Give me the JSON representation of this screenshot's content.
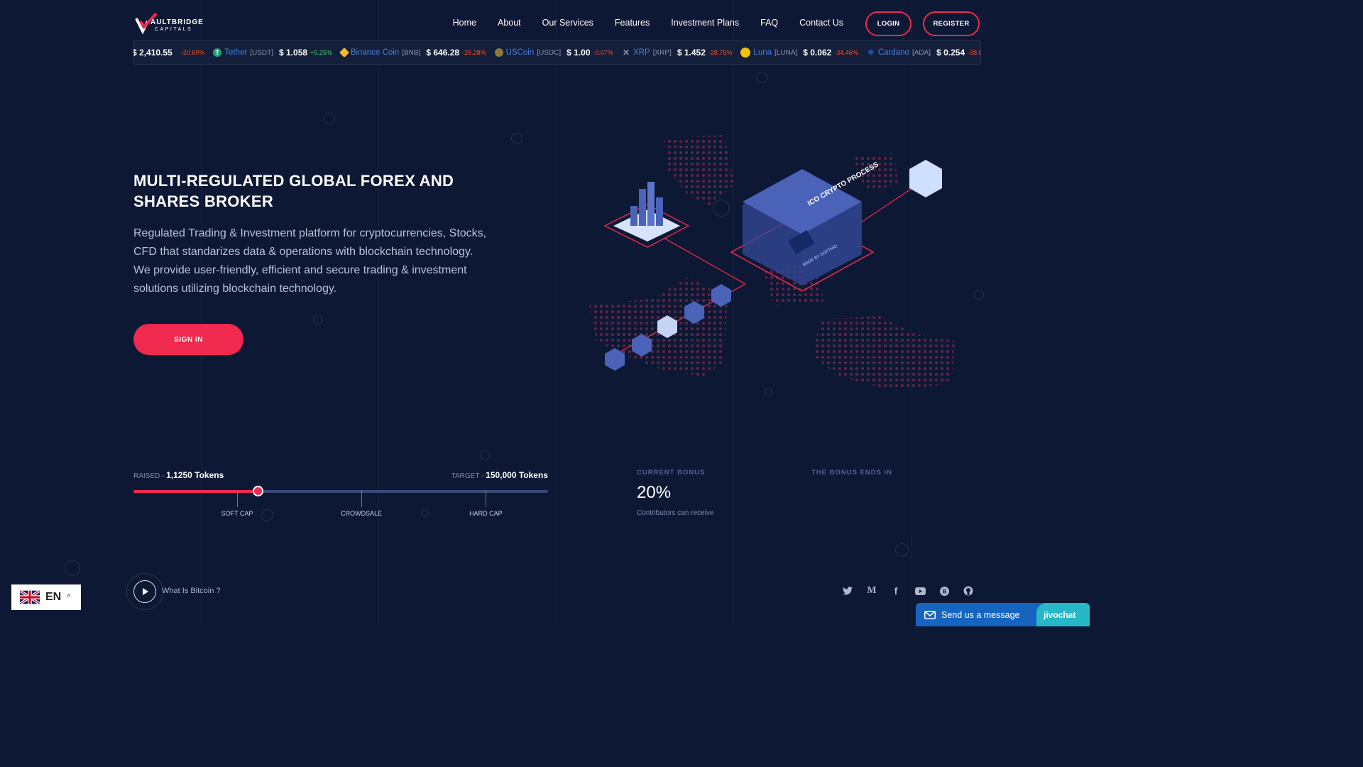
{
  "logo": {
    "name": "AULTBRIDGE",
    "sub": "CAPITALS"
  },
  "nav": {
    "items": [
      "Home",
      "About",
      "Our Services",
      "Features",
      "Investment Plans",
      "FAQ",
      "Contact Us"
    ],
    "login_label": "LOGIN",
    "register_label": "REGISTER"
  },
  "ticker": [
    {
      "name": "",
      "symbol": "",
      "price": "$ 2,410.55",
      "change": "-20.69%",
      "direction": "down",
      "icon": "ethereum-icon",
      "color": "#627eea"
    },
    {
      "name": "Tether",
      "symbol": "[USDT]",
      "price": "$ 1.058",
      "change": "+5.25%",
      "direction": "up",
      "icon": "tether-icon",
      "color": "#26a17b"
    },
    {
      "name": "Binance Coin",
      "symbol": "[BNB]",
      "price": "$ 646.28",
      "change": "-26.28%",
      "direction": "down",
      "icon": "binance-icon",
      "color": "#f3ba2f"
    },
    {
      "name": "USCoin",
      "symbol": "[USDC]",
      "price": "$ 1.00",
      "change": "-0.07%",
      "direction": "down",
      "icon": "usdc-icon",
      "color": "#8a7a3a"
    },
    {
      "name": "XRP",
      "symbol": "[XRP]",
      "price": "$ 1.452",
      "change": "-28.75%",
      "direction": "down",
      "icon": "xrp-icon",
      "color": "#8a94aa"
    },
    {
      "name": "Luna",
      "symbol": "[LUNA]",
      "price": "$ 0.062",
      "change": "-34.46%",
      "direction": "down",
      "icon": "luna-icon",
      "color": "#f5c200"
    },
    {
      "name": "Cardano",
      "symbol": "[ADA]",
      "price": "$ 0.254",
      "change": "-38.87%",
      "direction": "down",
      "icon": "cardano-icon",
      "color": "#2a5ada"
    }
  ],
  "hero": {
    "title": "MULTI-REGULATED GLOBAL FOREX AND SHARES BROKER",
    "description": "Regulated Trading & Investment platform for cryptocurrencies, Stocks, CFD that standarizes data & operations with blockchain technology. We provide user-friendly, efficient and secure trading & investment solutions utilizing blockchain technology.",
    "signin_label": "SIGN IN",
    "illustration": {
      "label": "ICO CRYPTO PROCESS",
      "chip_label": "MADE BY SOFTNIO",
      "bar_label": "MADE BY SOFTNIO"
    }
  },
  "progress": {
    "raised_label": "RAISED - ",
    "raised_value": "1,1250 Tokens",
    "target_label": "TARGET - ",
    "target_value": "150,000 Tokens",
    "fill_fraction": 0.3,
    "marks": [
      {
        "label": "SOFT CAP",
        "fraction": 0.25
      },
      {
        "label": "CROWDSALE",
        "fraction": 0.55
      },
      {
        "label": "HARD CAP",
        "fraction": 0.85
      }
    ]
  },
  "bonus": {
    "current_label": "CURRENT BONUS",
    "value": "20%",
    "sub": "Contributors can receive",
    "ends_label": "THE BONUS ENDS IN"
  },
  "video": {
    "label": "What Is Bitcoin ?"
  },
  "socials": [
    "twitter-icon",
    "medium-icon",
    "facebook-icon",
    "youtube-icon",
    "bitcoin-icon",
    "github-icon"
  ],
  "language": {
    "code": "EN"
  },
  "chat": {
    "label": "Send us a message",
    "brand": "jivochat"
  },
  "colors": {
    "background": "#0d1834",
    "accent": "#f0294f",
    "illustration": "#4a62b8"
  }
}
